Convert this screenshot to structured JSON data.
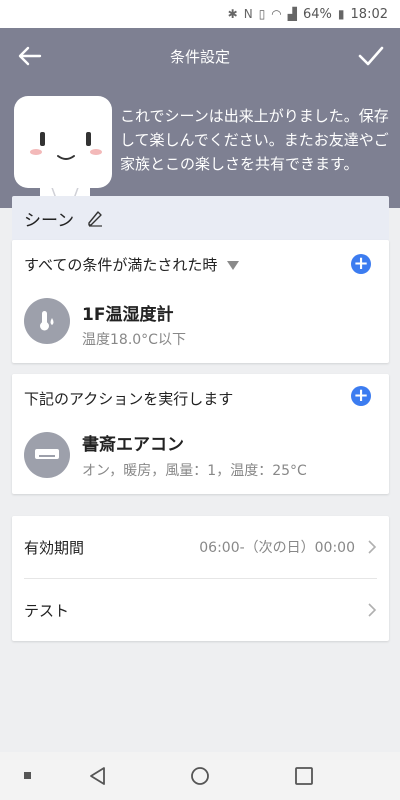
{
  "status": {
    "battery": "64%",
    "time": "18:02"
  },
  "header": {
    "title": "条件設定"
  },
  "hero": {
    "message": "これでシーンは出来上がりました。保存して楽しんでください。またお友達やご家族とこの楽しさを共有できます。"
  },
  "scene": {
    "label": "シーン"
  },
  "conditions": {
    "heading": "すべての条件が満たされた時",
    "device": {
      "name": "1F温湿度計",
      "detail": "温度18.0°C以下"
    }
  },
  "actions": {
    "heading": "下記のアクションを実行します",
    "device": {
      "name": "書斎エアコン",
      "detail": "オン，暖房，風量：1，温度：25°C"
    }
  },
  "settings": {
    "period_label": "有効期間",
    "period_value": "06:00-（次の日）00:00",
    "test_label": "テスト"
  },
  "colors": {
    "accent": "#3c7cf0",
    "hero_bg": "#7e8092"
  }
}
